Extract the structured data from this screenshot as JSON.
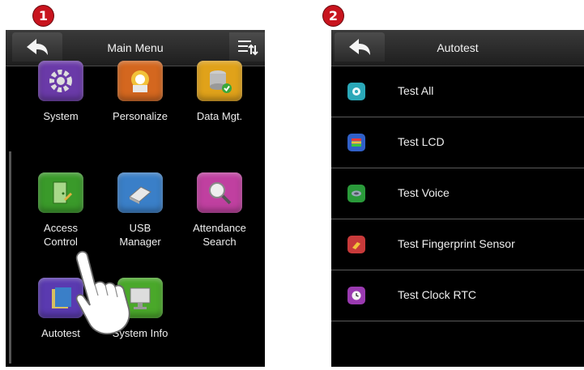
{
  "steps": [
    "1",
    "2"
  ],
  "main_menu": {
    "title": "Main Menu",
    "items": [
      {
        "label": "System",
        "icon": "gear-icon",
        "color": "#6a3aa8"
      },
      {
        "label": "Personalize",
        "icon": "color-palette-icon",
        "color": "#d4671f"
      },
      {
        "label": "Data Mgt.",
        "icon": "database-check-icon",
        "color": "#e0a21a"
      },
      {
        "label": "Access\nControl",
        "icon": "door-key-icon",
        "color": "#3a9a2a"
      },
      {
        "label": "USB\nManager",
        "icon": "usb-drive-icon",
        "color": "#3a7fc8"
      },
      {
        "label": "Attendance\nSearch",
        "icon": "magnifier-icon",
        "color": "#c040a0"
      },
      {
        "label": "Autotest",
        "icon": "autotest-icon",
        "color": "#5a3ab0"
      },
      {
        "label": "System Info",
        "icon": "monitor-icon",
        "color": "#4aa82a"
      }
    ]
  },
  "autotest": {
    "title": "Autotest",
    "items": [
      {
        "label": "Test All",
        "icon": "test-all-icon",
        "color": "#2aa8b8"
      },
      {
        "label": "Test LCD",
        "icon": "lcd-icon",
        "color": "#3060c8"
      },
      {
        "label": "Test Voice",
        "icon": "speaker-icon",
        "color": "#2a9a3a"
      },
      {
        "label": "Test Fingerprint Sensor",
        "icon": "fingerprint-icon",
        "color": "#c83a3a"
      },
      {
        "label": "Test Clock RTC",
        "icon": "clock-icon",
        "color": "#9a3ab0"
      }
    ]
  }
}
